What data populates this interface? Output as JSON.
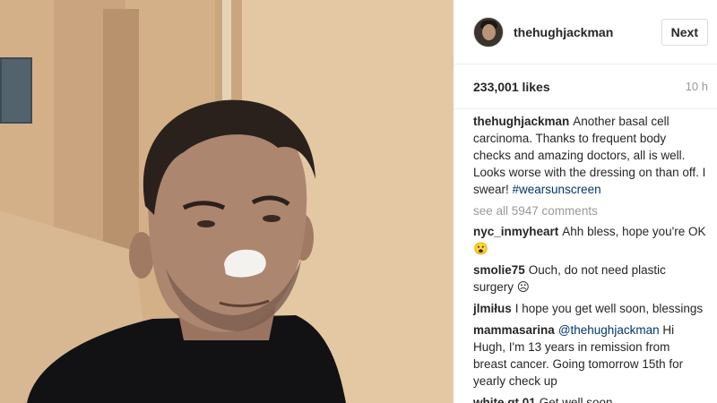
{
  "post": {
    "username": "thehughjackman",
    "next_label": "Next",
    "likes": "233,001 likes",
    "time": "10 h"
  },
  "caption": {
    "user": "thehughjackman",
    "text": "Another basal cell carcinoma. Thanks to frequent body checks and amazing doctors, all is well. Looks worse with the dressing on than off. I swear!",
    "hashtag": "#wearsunscreen"
  },
  "see_all": "see all 5947 comments",
  "comments": [
    {
      "user": "nyc_inmyheart",
      "text": "Ahh bless, hope you're OK 😮"
    },
    {
      "user": "smolie75",
      "text": "Ouch, do not need plastic surgery ☹"
    },
    {
      "user": "jlmiłus",
      "text": "I hope you get well soon, blessings"
    },
    {
      "user": "mammasarina",
      "mention": "@thehughjackman",
      "text": "Hi Hugh, I'm 13 years in remission from breast cancer. Going tomorrow 15th for yearly check up"
    },
    {
      "user": "white.gt.01",
      "text": "Get well soon."
    }
  ],
  "icons": {
    "avatar": "profile-avatar"
  }
}
